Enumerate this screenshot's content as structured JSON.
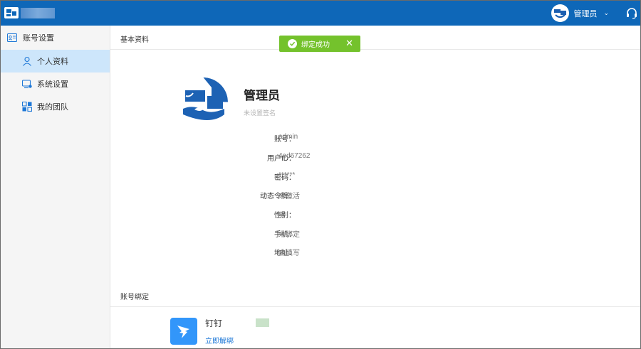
{
  "header": {
    "user_name": "管理员",
    "caret": "⌄"
  },
  "sidebar": {
    "section_title": "账号设置",
    "items": [
      {
        "label": "个人资料",
        "active": true
      },
      {
        "label": "系统设置",
        "active": false
      },
      {
        "label": "我的团队",
        "active": false
      }
    ]
  },
  "toast": {
    "message": "绑定成功",
    "close": "✕"
  },
  "profile": {
    "section_title": "基本资料",
    "name": "管理员",
    "signature": "未设置签名",
    "fields": [
      {
        "label": "账号：",
        "value": "admin"
      },
      {
        "label": "用户ID：",
        "value": "4ed67262"
      },
      {
        "label": "密码：",
        "value": "******"
      },
      {
        "label": "动态令牌：",
        "value": "未激活"
      },
      {
        "label": "性别：",
        "value": "男"
      },
      {
        "label": "手机：",
        "value": "未绑定"
      },
      {
        "label": "地址：",
        "value": "未填写"
      }
    ]
  },
  "binding": {
    "section_title": "账号绑定",
    "dingtalk_name": "钉钉",
    "dingtalk_action": "立即解绑"
  },
  "colors": {
    "topbar": "#0e67b8",
    "active_item": "#cde6fb",
    "toast": "#74c22c",
    "link": "#1e78d7",
    "dingtalk": "#3296fa"
  }
}
